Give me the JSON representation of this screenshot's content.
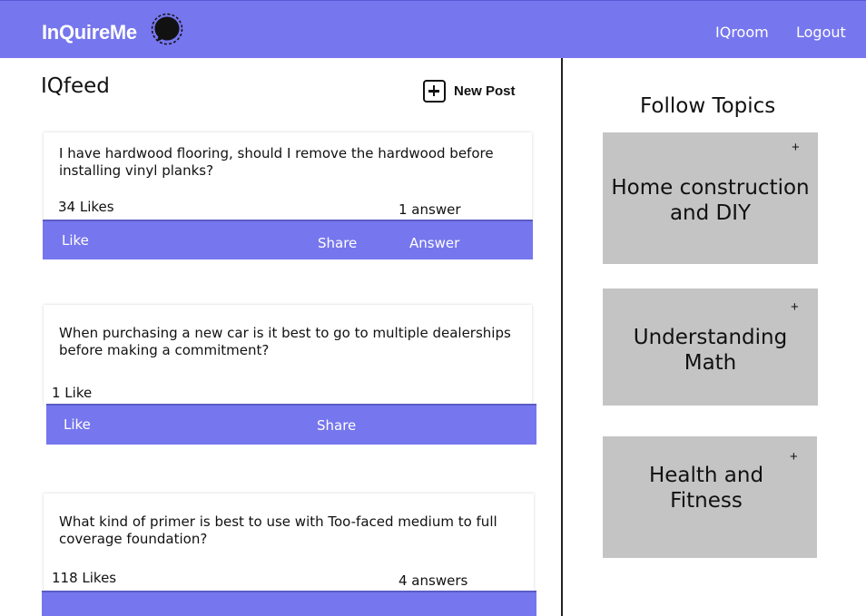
{
  "header": {
    "brand": "InQuireMe",
    "logo_icon": "speech-bubble-icon",
    "nav": [
      "IQroom",
      "Logout"
    ]
  },
  "feed": {
    "title": "IQfeed",
    "new_post_label": "New Post",
    "new_post_icon": "plus-square-icon",
    "posts": [
      {
        "question": "I have hardwood flooring, should I remove the hardwood before installing vinyl planks?",
        "likes": "34 Likes",
        "answers": "1 answer",
        "actions": [
          "Like",
          "Share",
          "Answer"
        ]
      },
      {
        "question": "When purchasing a new car is it best to go to multiple dealerships before making a commitment?",
        "likes": "1 Like",
        "answers": "",
        "actions": [
          "Like",
          "Share"
        ]
      },
      {
        "question": "What kind of primer is best to use with Too-faced medium to full coverage foundation?",
        "likes": "118 Likes",
        "answers": "4 answers",
        "actions": []
      }
    ]
  },
  "topics": {
    "title": "Follow Topics",
    "plus": "+",
    "items": [
      {
        "line1": "Home construction",
        "line2": "and DIY"
      },
      {
        "line1": "Understanding",
        "line2": "Math"
      },
      {
        "line1": "Health and",
        "line2": "Fitness"
      }
    ]
  },
  "colors": {
    "accent": "#7676ee",
    "topic_card": "#c4c4c4",
    "text": "#111111"
  }
}
